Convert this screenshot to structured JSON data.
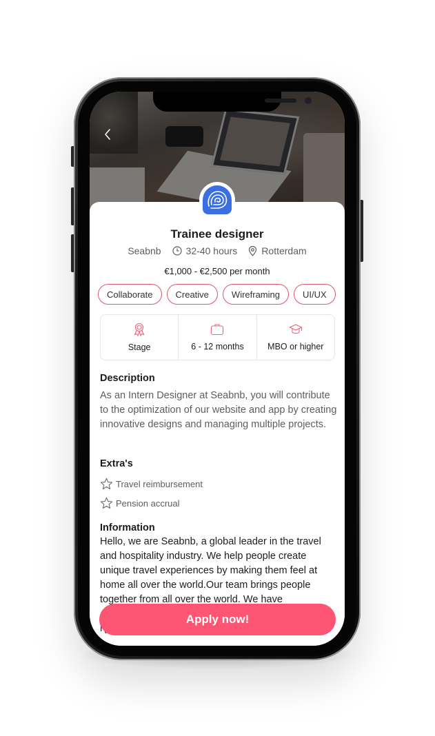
{
  "job": {
    "title": "Trainee designer",
    "company": "Seabnb",
    "hours": "32-40 hours",
    "location": "Rotterdam",
    "salary": "€1,000 - €2,500 per month",
    "logo_icon": "spiral-logo-icon"
  },
  "tags": [
    "Collaborate",
    "Creative",
    "Wireframing",
    "UI/UX"
  ],
  "info_cells": [
    {
      "icon": "award-ribbon-icon",
      "label": "Stage"
    },
    {
      "icon": "briefcase-icon",
      "label": "6 - 12 months"
    },
    {
      "icon": "graduation-cap-icon",
      "label": "MBO or higher"
    }
  ],
  "description": {
    "heading": "Description",
    "text": "As an Intern Designer at Seabnb, you will contribute to the optimization of our website and app by creating innovative designs and managing multiple projects."
  },
  "extras": {
    "heading": "Extra's",
    "items": [
      "Travel reimbursement",
      "Pension accrual"
    ]
  },
  "information": {
    "heading": "Information",
    "text": "Hello, we are Seabnb, a global leader in the travel and hospitality industry. We help people create unique travel experiences by making them feel at home all over the world.Our team brings people together from all over the world. We have",
    "continued": "r(s). This amazing fusion of talents allows us t"
  },
  "cta": {
    "apply_label": "Apply now!"
  },
  "colors": {
    "accent": "#fd5573",
    "tag_border": "#e0566e",
    "logo": "#3a6fe3"
  }
}
